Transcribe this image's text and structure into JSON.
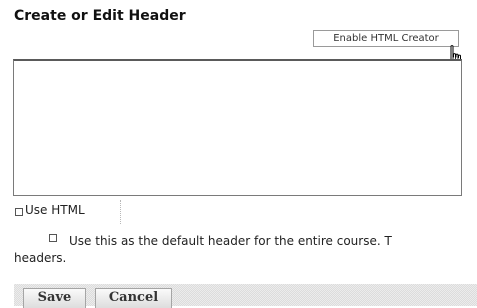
{
  "form": {
    "title": "Create or Edit Header",
    "html_creator_label": "Enable HTML Creator",
    "use_html_label": "Use HTML",
    "default_header_line1": "Use this as the default header for the entire course. T",
    "default_header_line2": "headers.",
    "use_html_checked": false,
    "default_header_checked": false
  },
  "buttons": {
    "save_label": "Save",
    "cancel_label": "Cancel"
  },
  "cursor": {
    "icon": "hand-pointer-icon"
  }
}
